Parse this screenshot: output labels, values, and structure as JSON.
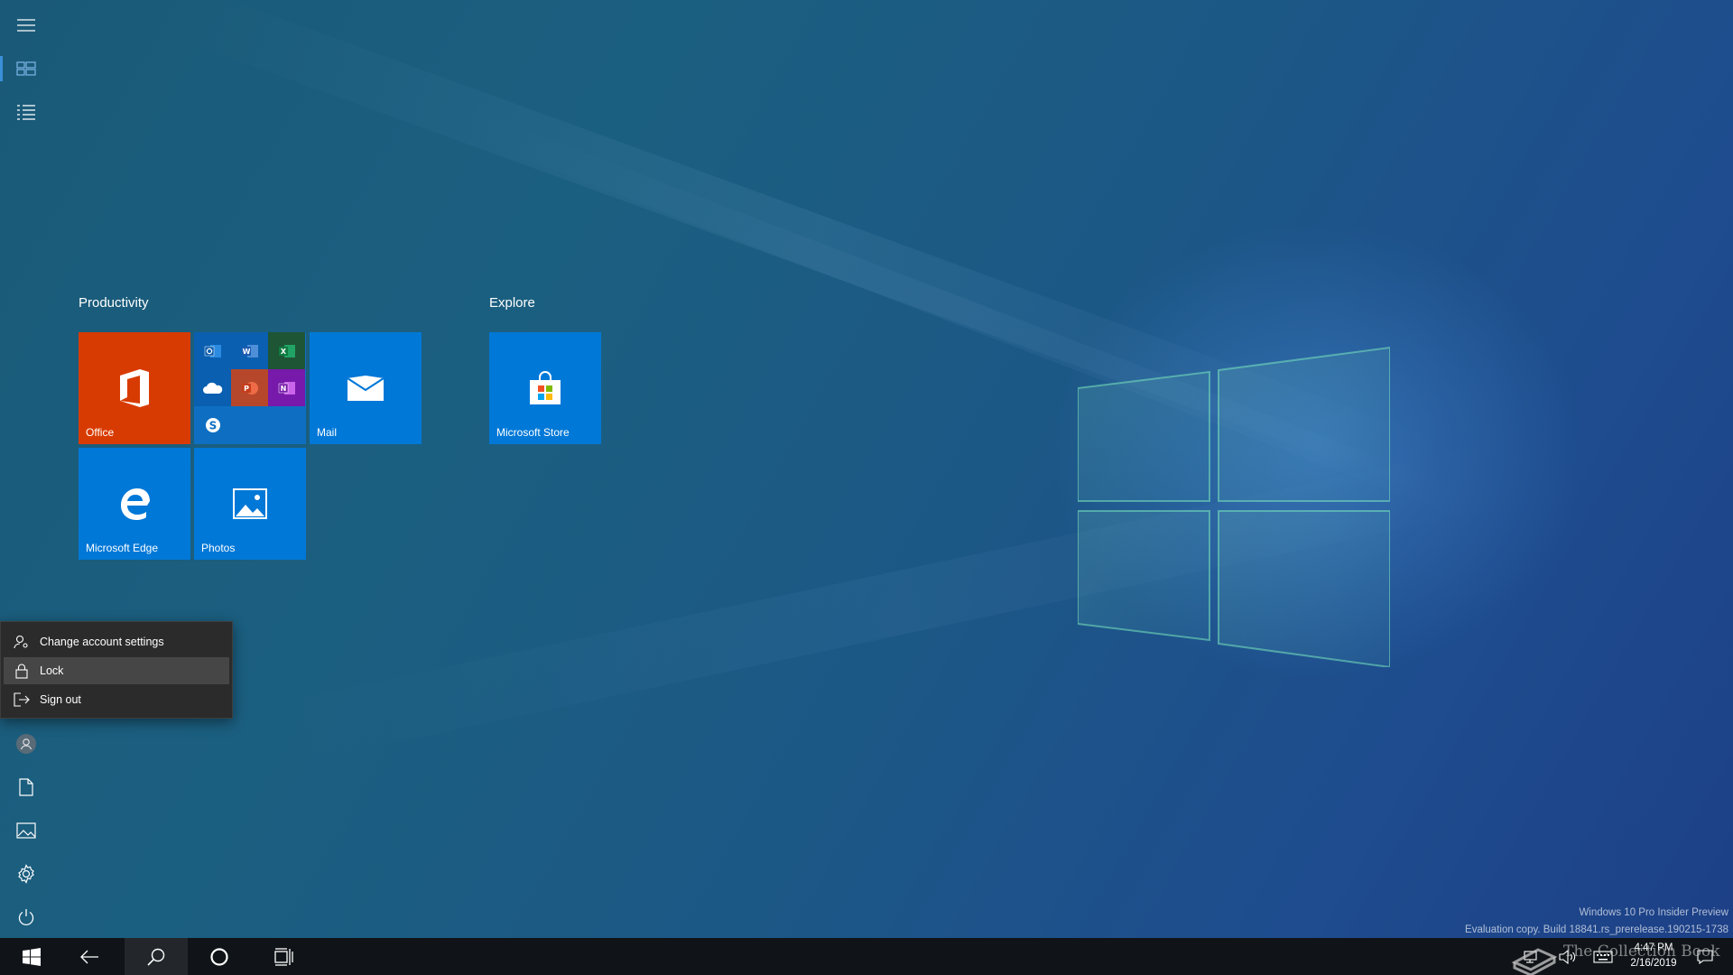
{
  "start": {
    "groups": [
      {
        "title": "Productivity"
      },
      {
        "title": "Explore"
      }
    ],
    "tiles": {
      "office": {
        "label": "Office",
        "color": "#d83b01"
      },
      "office_apps": {
        "apps": [
          "outlook-icon",
          "word-icon",
          "excel-icon",
          "onedrive-icon",
          "powerpoint-icon",
          "onenote-icon",
          "skype-icon"
        ]
      },
      "mail": {
        "label": "Mail",
        "color": "#0078d7"
      },
      "edge": {
        "label": "Microsoft Edge",
        "color": "#0078d7"
      },
      "photos": {
        "label": "Photos",
        "color": "#0078d7"
      },
      "store": {
        "label": "Microsoft Store",
        "color": "#0078d7"
      }
    },
    "rail": {
      "top": [
        "hamburger-menu-icon",
        "pinned-tiles-icon",
        "all-apps-list-icon"
      ],
      "bottom": [
        "user-avatar-icon",
        "documents-icon",
        "pictures-icon",
        "settings-gear-icon",
        "power-icon"
      ]
    },
    "account_menu": [
      {
        "label": "Change account settings",
        "icon": "person-settings-icon"
      },
      {
        "label": "Lock",
        "icon": "lock-icon"
      },
      {
        "label": "Sign out",
        "icon": "sign-out-icon"
      }
    ]
  },
  "watermark": {
    "line1": "Windows 10 Pro Insider Preview",
    "line2": "Evaluation copy. Build 18841.rs_prerelease.190215-1738"
  },
  "taskbar": {
    "buttons": [
      "start-windows-icon",
      "back-arrow-icon",
      "search-icon",
      "cortana-circle-icon",
      "task-view-icon"
    ],
    "tray": [
      "network-icon",
      "volume-icon",
      "keyboard-icon",
      "action-center-icon"
    ],
    "time": "4:47 PM",
    "date": "2/16/2019",
    "overlay_text": "The Collection Book"
  },
  "colors": {
    "accent": "#0078d7",
    "office_orange": "#d83b01",
    "taskbar": "#101418",
    "flyout": "#2b2b2b"
  }
}
